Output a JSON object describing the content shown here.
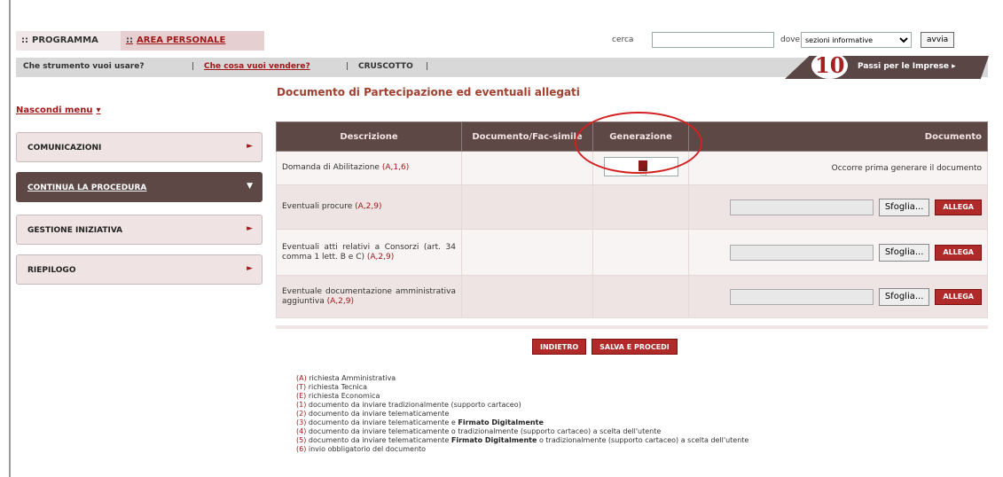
{
  "topnav": {
    "prefix": "::",
    "tab_programma": "PROGRAMMA",
    "tab_area": "AREA PERSONALE"
  },
  "search": {
    "cerca_label": "cerca",
    "cerca_value": "",
    "dove_label": "dove",
    "dove_value": "sezioni informative",
    "button": "avvia"
  },
  "subbar": {
    "q1": "Che strumento vuoi usare?",
    "q2": "Che cosa vuoi vendere?",
    "q3": "CRUSCOTTO",
    "sep": "|"
  },
  "banner": {
    "number": "10",
    "text": "Passi per le Imprese"
  },
  "sidebar": {
    "hide_menu": "Nascondi menu",
    "items": [
      {
        "label": "COMUNICAZIONI"
      },
      {
        "label": "CONTINUA LA PROCEDURA"
      },
      {
        "label": "GESTIONE INIZIATIVA"
      },
      {
        "label": "RIEPILOGO"
      }
    ]
  },
  "page_title": "Documento di Partecipazione ed eventuali allegati",
  "table": {
    "headers": {
      "descrizione": "Descrizione",
      "fac_simile": "Documento/Fac-simile",
      "generazione": "Generazione",
      "documento": "Documento"
    },
    "rows": [
      {
        "desc": "Domanda di Abilitazione",
        "ref": "(A,1,6)",
        "doc_text": "Occorre prima generare il documento"
      },
      {
        "desc": "Eventuali procure",
        "ref": "(A,2,9)"
      },
      {
        "desc": "Eventuali atti relativi a Consorzi (art. 34 comma 1 lett. B e C)",
        "ref": "(A,2,9)"
      },
      {
        "desc": "Eventuale documentazione amministrativa aggiuntiva",
        "ref": "(A,2,9)"
      }
    ],
    "browse_label": "Sfoglia...",
    "allega_label": "ALLEGA"
  },
  "actions": {
    "back": "INDIETRO",
    "save": "SALVA E PROCEDI"
  },
  "legend": [
    {
      "code": "(A)",
      "text": "richiesta Amministrativa"
    },
    {
      "code": "(T)",
      "text": "richiesta Tecnica"
    },
    {
      "code": "(E)",
      "text": "richiesta Economica"
    },
    {
      "code": "(1)",
      "text": "documento da inviare tradizionalmente (supporto cartaceo)"
    },
    {
      "code": "(2)",
      "text": "documento da inviare telematicamente"
    },
    {
      "code": "(3)",
      "text": "documento da inviare telematicamente e",
      "bold": "Firmato Digitalmente"
    },
    {
      "code": "(4)",
      "text": "documento da inviare telematicamente o tradizionalmente (supporto cartaceo) a scelta dell'utente"
    },
    {
      "code": "(5)",
      "text": "documento da inviare telematicamente",
      "bold": "Firmato Digitalmente",
      "tail": "o tradizionalmente (supporto cartaceo) a scelta dell'utente"
    },
    {
      "code": "(6)",
      "text": "invio obbligatorio del documento"
    }
  ],
  "colors": {
    "accent": "#a01818",
    "header_bg": "#5d4846",
    "row_alt": "#efe4e4",
    "highlight_circle": "#d32020"
  }
}
